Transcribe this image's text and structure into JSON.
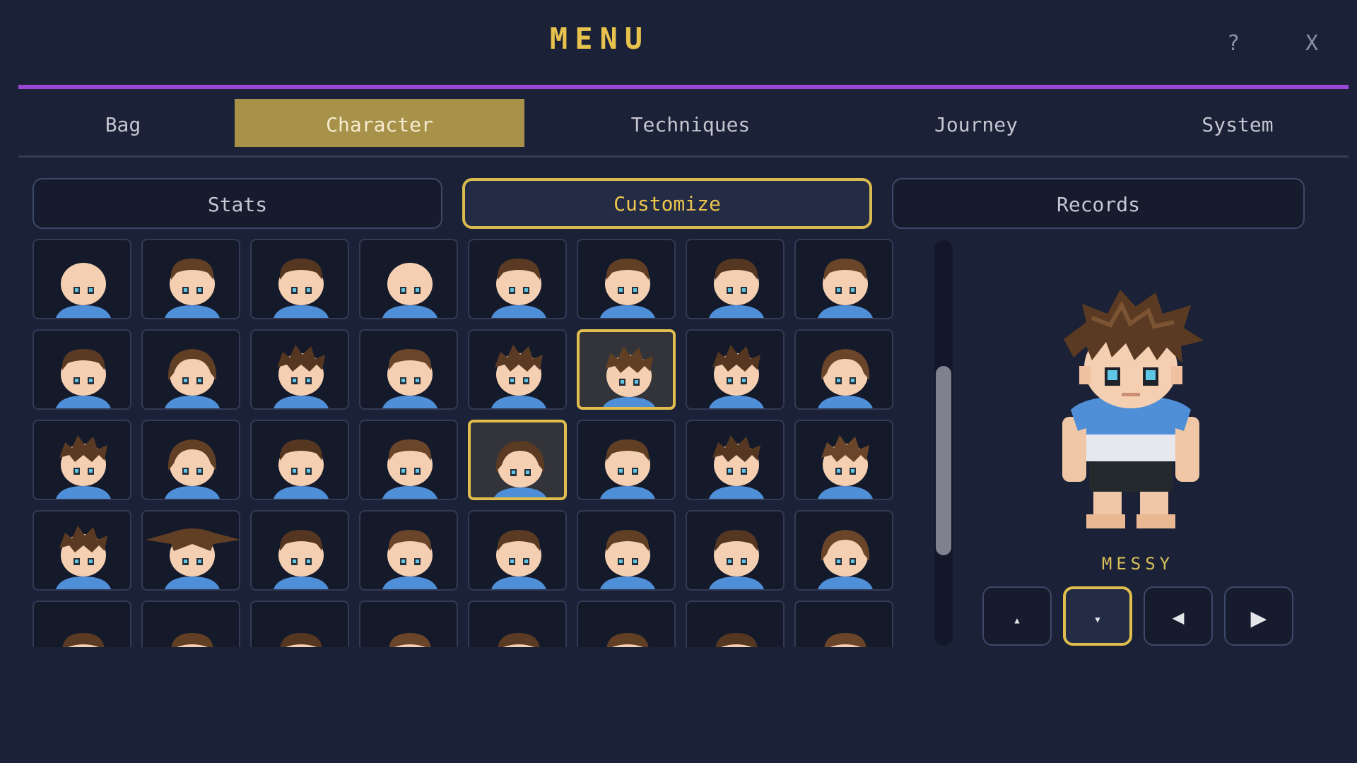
{
  "menu": {
    "title": "MENU",
    "help_label": "?",
    "close_label": "X"
  },
  "tabs": [
    {
      "label": "Bag"
    },
    {
      "label": "Character"
    },
    {
      "label": "Techniques"
    },
    {
      "label": "Journey"
    },
    {
      "label": "System"
    }
  ],
  "active_tab": "Character",
  "subtabs": [
    {
      "label": "Stats"
    },
    {
      "label": "Customize"
    },
    {
      "label": "Records"
    }
  ],
  "active_subtab": "Customize",
  "hair_grid": {
    "columns": 8,
    "selected": [
      13,
      20
    ],
    "styles": [
      "bald",
      "short-bowl",
      "short-crop",
      "bald-thin",
      "mohawk-short",
      "flat-top",
      "buzz",
      "side-part",
      "shaggy",
      "long-sweep",
      "spiky-short",
      "pompadour",
      "spiky",
      "messy",
      "wild-spikes",
      "twin-tails",
      "tousled",
      "mop",
      "bowl",
      "curly",
      "long-curly",
      "short-curly",
      "swept-up",
      "spiky-back",
      "spiky-up",
      "wide-brim",
      "mohawk",
      "cornrows",
      "afro-top",
      "dreads",
      "topknot",
      "bob",
      "partial-1",
      "partial-2",
      "partial-3",
      "partial-4",
      "partial-5",
      "partial-6",
      "partial-7",
      "partial-8"
    ]
  },
  "preview": {
    "style_name": "MESSY",
    "hair_color": "#5a3a22",
    "skin_color": "#f4cfb1",
    "shirt_color": "#4f8fd8"
  },
  "controls": [
    {
      "name": "up",
      "glyph": "▲"
    },
    {
      "name": "down",
      "glyph": "▼"
    },
    {
      "name": "prev",
      "glyph": "◀"
    },
    {
      "name": "next",
      "glyph": "▶"
    }
  ],
  "colors": {
    "accent_purple": "#9a46d6",
    "gold": "#dfbe4e",
    "tab_active": "#a8924a"
  }
}
